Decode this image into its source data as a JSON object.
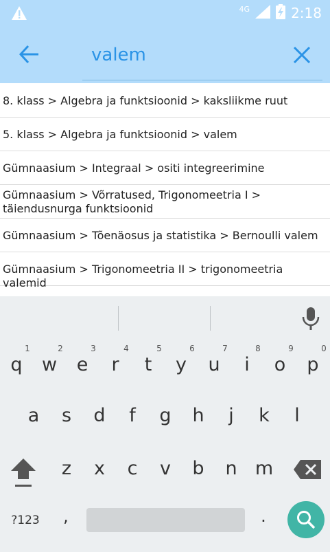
{
  "status_bar": {
    "network": "4G",
    "time": "2:18"
  },
  "search": {
    "query": "valem"
  },
  "results": [
    {
      "text": "8. klass > Algebra ja funktsioonid > kaksliikme ruut"
    },
    {
      "text": "5. klass > Algebra ja funktsioonid > valem"
    },
    {
      "text": "Gümnaasium > Integraal > ositi integreerimine"
    },
    {
      "text": "Gümnaasium > Võrratused, Trigonomeetria I > täiendusnurga funktsioonid"
    },
    {
      "text": "Gümnaasium > Tõenäosus ja statistika > Bernoulli valem"
    },
    {
      "text": "Gümnaasium > Trigonomeetria II > trigonomeetria valemid"
    }
  ],
  "keyboard": {
    "row1": [
      {
        "key": "q",
        "hint": "1"
      },
      {
        "key": "w",
        "hint": "2"
      },
      {
        "key": "e",
        "hint": "3"
      },
      {
        "key": "r",
        "hint": "4"
      },
      {
        "key": "t",
        "hint": "5"
      },
      {
        "key": "y",
        "hint": "6"
      },
      {
        "key": "u",
        "hint": "7"
      },
      {
        "key": "i",
        "hint": "8"
      },
      {
        "key": "o",
        "hint": "9"
      },
      {
        "key": "p",
        "hint": "0"
      }
    ],
    "row2": [
      "a",
      "s",
      "d",
      "f",
      "g",
      "h",
      "j",
      "k",
      "l"
    ],
    "row3": [
      "z",
      "x",
      "c",
      "v",
      "b",
      "n",
      "m"
    ],
    "symbols_label": "?123",
    "comma": ",",
    "period": ".",
    "accent_color": "#41b5a6"
  },
  "colors": {
    "header_bg": "#b3dcfb",
    "accent": "#2a93e6"
  }
}
